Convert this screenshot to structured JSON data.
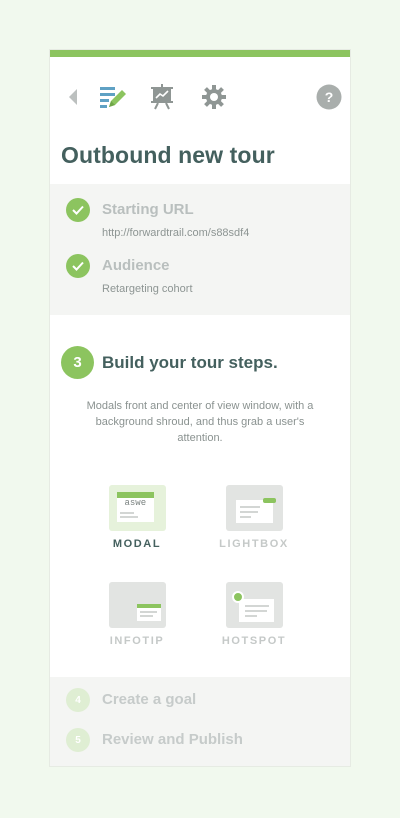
{
  "colors": {
    "accent": "#8cc45f",
    "heading": "#44605e",
    "muted": "#b9bfbe"
  },
  "toolbar": {
    "items": [
      {
        "icon": "chevron-left-icon"
      },
      {
        "icon": "edit-list-icon",
        "active": true
      },
      {
        "icon": "presentation-icon"
      },
      {
        "icon": "gear-icon"
      },
      {
        "icon": "help-icon",
        "glyph": "?"
      }
    ]
  },
  "page": {
    "title": "Outbound new tour"
  },
  "completed_steps": [
    {
      "title": "Starting URL",
      "value": "http://forwardtrail.com/s88sdf4"
    },
    {
      "title": "Audience",
      "value": "Retargeting cohort"
    }
  ],
  "active_step": {
    "number": "3",
    "title": "Build your tour steps.",
    "description": "Modals front and center of view window, with a background shroud, and thus grab a user's attention."
  },
  "step_types": [
    {
      "label": "MODAL",
      "preview_text": "aswe",
      "selected": true
    },
    {
      "label": "LIGHTBOX",
      "selected": false
    },
    {
      "label": "INFOTIP",
      "selected": false
    },
    {
      "label": "HOTSPOT",
      "selected": false
    }
  ],
  "upcoming_steps": [
    {
      "number": "4",
      "title": "Create a goal"
    },
    {
      "number": "5",
      "title": "Review and Publish"
    }
  ]
}
